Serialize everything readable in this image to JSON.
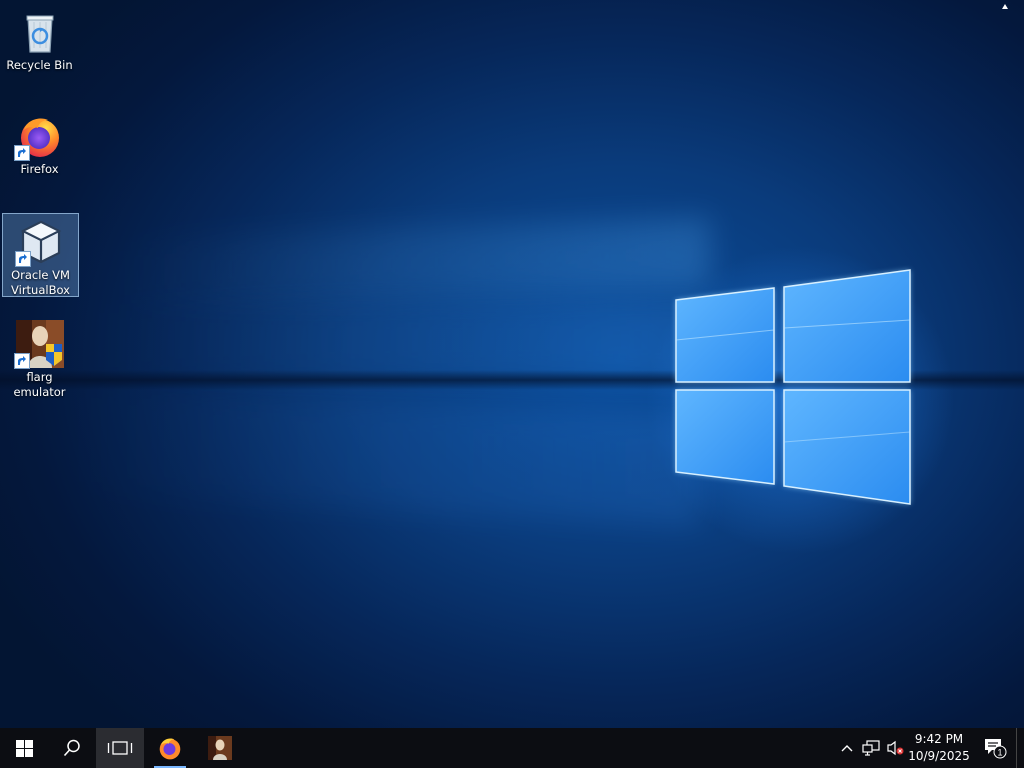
{
  "desktop": {
    "icons": [
      {
        "label": "Recycle Bin",
        "icon": "recycle-bin-icon"
      },
      {
        "label": "Firefox",
        "icon": "firefox-icon"
      },
      {
        "label": "Oracle VM VirtualBox",
        "icon": "virtualbox-icon",
        "selected": true
      },
      {
        "label": "flarg emulator",
        "icon": "flarg-emulator-icon"
      }
    ],
    "wallpaper": "windows-10-default"
  },
  "taskbar": {
    "start": "windows-start-icon",
    "search": "search-icon",
    "task_view": "task-view-icon",
    "pinned": [
      {
        "name": "Firefox",
        "icon": "firefox-icon",
        "running": true
      },
      {
        "name": "flarg emulator",
        "icon": "flarg-emulator-icon",
        "running": false
      }
    ],
    "tray": {
      "show_hidden": "chevron-up-icon",
      "network": "network-icon",
      "volume": "volume-muted-icon",
      "time": "9:42 PM",
      "date": "10/9/2025",
      "notifications_count": "1"
    }
  },
  "colors": {
    "taskbar": "#0c0d12",
    "accent": "#7ab7ff",
    "selection": "#7aaad8"
  }
}
